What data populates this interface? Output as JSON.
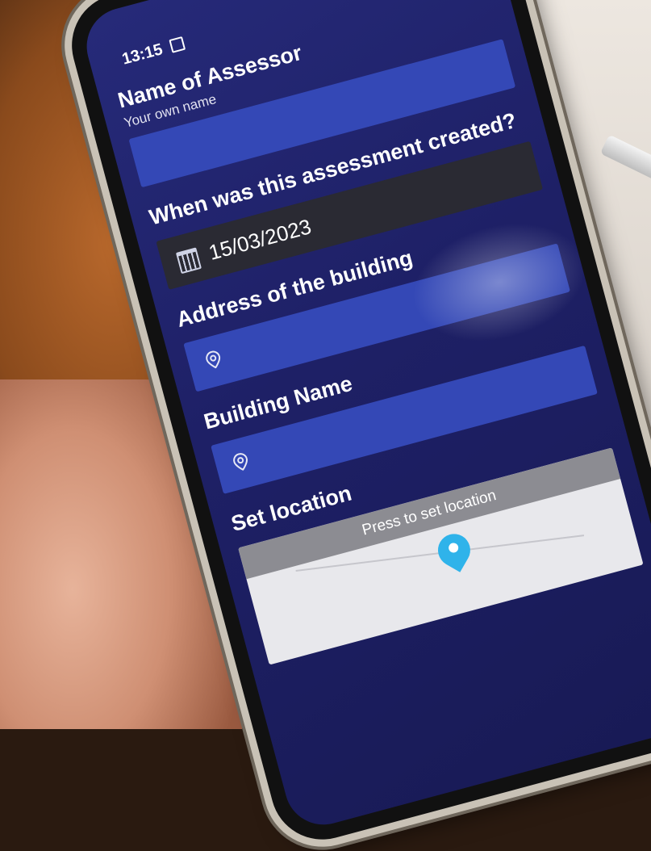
{
  "status_bar": {
    "time": "13:15",
    "icons": [
      "signal-icon",
      "wifi-icon",
      "notification-icon"
    ]
  },
  "form": {
    "assessor": {
      "label": "Name of Assessor",
      "hint": "Your own name",
      "value": ""
    },
    "date": {
      "label": "When was this assessment created?",
      "value": "15/03/2023",
      "icon": "calendar-icon"
    },
    "address": {
      "label": "Address of the building",
      "value": "",
      "icon": "location-pin-icon"
    },
    "building_name": {
      "label": "Building Name",
      "value": "",
      "icon": "location-pin-icon"
    },
    "location": {
      "label": "Set location",
      "map_prompt": "Press to set location"
    }
  },
  "colors": {
    "screen_background": "#1e2066",
    "input_field": "#3448b6",
    "date_field": "#2a2a33",
    "map_banner": "#8c8c92",
    "map_pin": "#2fb3ea"
  }
}
